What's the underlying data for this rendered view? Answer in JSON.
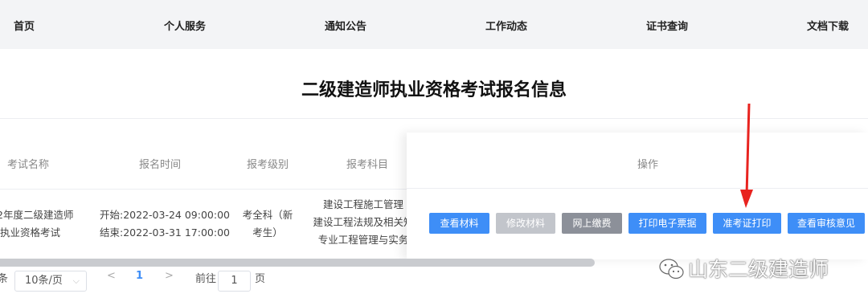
{
  "nav": [
    "首页",
    "个人服务",
    "通知公告",
    "工作动态",
    "证书查询",
    "文档下载"
  ],
  "page_title": "二级建造师执业资格考试报名信息",
  "table": {
    "headers": {
      "exam_name": "考试名称",
      "reg_time": "报名时间",
      "level": "报考级别",
      "subjects": "报考科目",
      "actions": "操作"
    },
    "row": {
      "exam_name": [
        "2年度二级建造师",
        "执业资格考试"
      ],
      "reg_time": [
        "开始:2022-03-24 09:00:00",
        "结束:2022-03-31 17:00:00"
      ],
      "level": [
        "考全科（新",
        "考生）"
      ],
      "subjects": [
        "建设工程施工管理",
        "建设工程法规及相关知",
        "专业工程管理与实务"
      ]
    },
    "actions": [
      "查看材料",
      "修改材料",
      "网上缴费",
      "打印电子票据",
      "准考证打印",
      "查看审核意见"
    ]
  },
  "pagination": {
    "prefix": "条",
    "page_size": "10条/页",
    "prev": "<",
    "current_page": "1",
    "next": ">",
    "goto_label": "前往",
    "goto_value": "1",
    "page_suffix": "页"
  },
  "watermark": "山东二级建造师",
  "annotation_color": "#e8231f"
}
